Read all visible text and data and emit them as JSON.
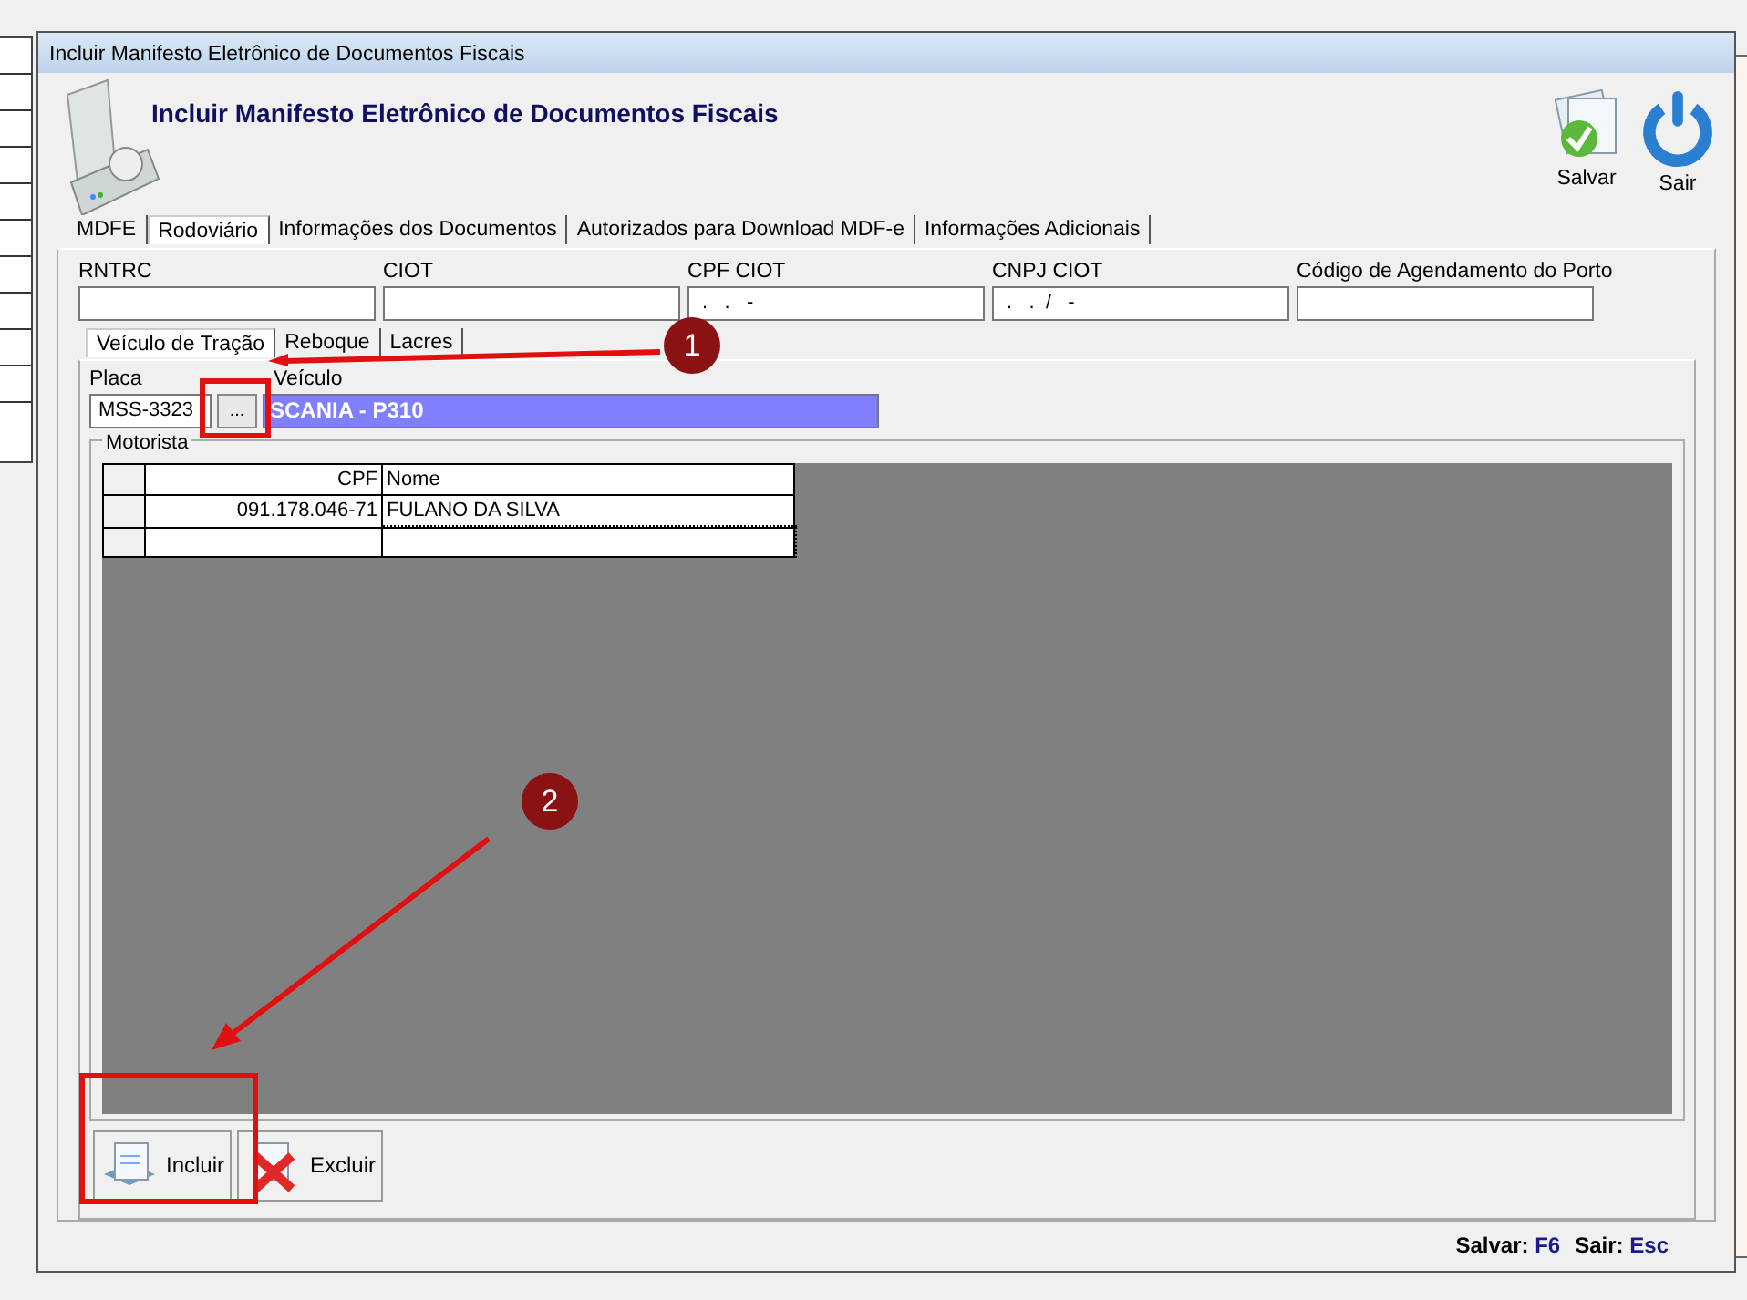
{
  "window": {
    "title": "Incluir Manifesto Eletrônico de Documentos Fiscais"
  },
  "header": {
    "title": "Incluir Manifesto Eletrônico de Documentos Fiscais"
  },
  "toolbar": [
    {
      "kind": "save",
      "label": "Salvar"
    },
    {
      "kind": "exit",
      "label": "Sair"
    }
  ],
  "tabs": [
    {
      "label": "MDFE",
      "selected": false
    },
    {
      "label": "Rodoviário",
      "selected": true
    },
    {
      "label": "Informações dos Documentos",
      "selected": false
    },
    {
      "label": "Autorizados para Download MDF-e",
      "selected": false
    },
    {
      "label": "Informações Adicionais",
      "selected": false
    }
  ],
  "fields": [
    {
      "label": "RNTRC"
    },
    {
      "label": "CIOT"
    },
    {
      "label": "CPF CIOT",
      "value": " .   .   -"
    },
    {
      "label": "CNPJ CIOT",
      "value": " .   .  /   -"
    },
    {
      "label": "Código de Agendamento do Porto"
    }
  ],
  "subtabs": [
    {
      "label": "Veículo de Tração",
      "selected": true
    },
    {
      "label": "Reboque",
      "selected": false
    },
    {
      "label": "Lacres",
      "selected": false
    }
  ],
  "vehicle": {
    "plate_label": "Placa",
    "plate": "MSS-3323",
    "lookup_button": "...",
    "vehicle_label": "Veículo",
    "vehicle": "SCANIA - P310"
  },
  "drivers": {
    "title": "Motorista",
    "columns": [
      "CPF",
      "Nome"
    ],
    "rows": [
      [
        "091.178.046-71",
        "FULANO DA SILVA"
      ],
      [
        "",
        ""
      ]
    ]
  },
  "actions": [
    {
      "kind": "add",
      "label": "Incluir"
    },
    {
      "kind": "delete",
      "label": "Excluir"
    }
  ],
  "shortcuts": [
    {
      "label": "Salvar:",
      "key": "F6"
    },
    {
      "label": "Sair:",
      "key": "Esc"
    }
  ],
  "annotations": [
    {
      "number": "1"
    },
    {
      "number": "2"
    }
  ]
}
